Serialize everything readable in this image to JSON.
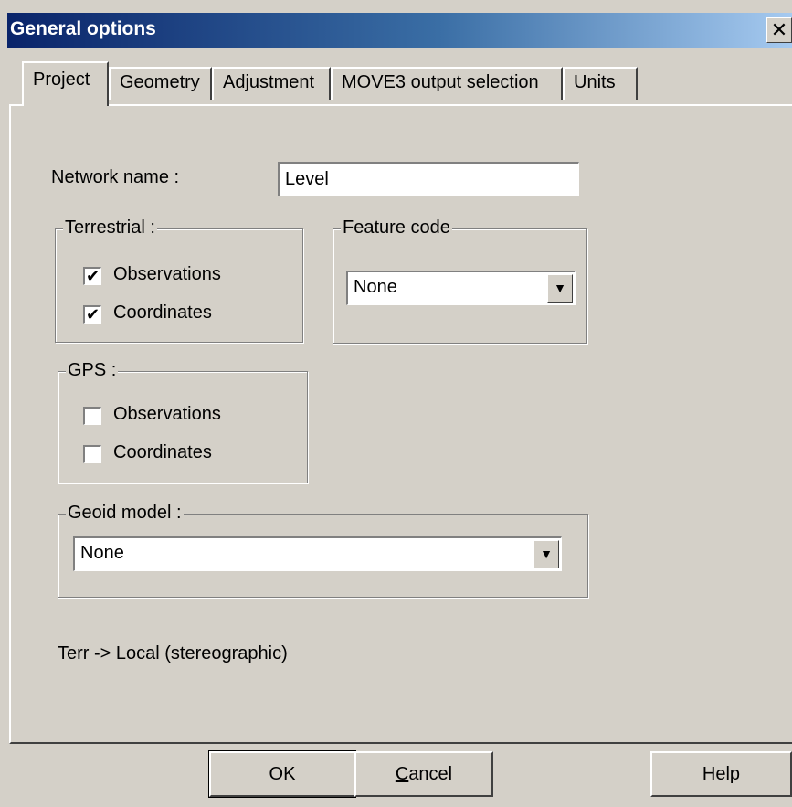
{
  "window": {
    "title": "General options",
    "close_glyph": "✕"
  },
  "tabs": [
    {
      "label": "Project",
      "active": true
    },
    {
      "label": "Geometry",
      "active": false
    },
    {
      "label": "Adjustment",
      "active": false
    },
    {
      "label": "MOVE3 output selection",
      "active": false
    },
    {
      "label": "Units",
      "active": false
    }
  ],
  "project": {
    "network_name_label": "Network name :",
    "network_name_value": "Level",
    "terrestrial": {
      "title": "Terrestrial :",
      "observations_label": "Observations",
      "observations_checked": true,
      "coordinates_label": "Coordinates",
      "coordinates_checked": true
    },
    "feature_code": {
      "title": "Feature code",
      "selected": "None"
    },
    "gps": {
      "title": "GPS :",
      "observations_label": "Observations",
      "observations_checked": false,
      "coordinates_label": "Coordinates",
      "coordinates_checked": false
    },
    "geoid_model": {
      "title": "Geoid model :",
      "selected": "None"
    },
    "projection_text": "Terr -> Local (stereographic)"
  },
  "buttons": {
    "ok": "OK",
    "cancel_underlined": "C",
    "cancel_rest": "ancel",
    "help": "Help"
  },
  "icons": {
    "check": "check-mark",
    "dropdown": "down-arrow",
    "close": "close-x"
  }
}
